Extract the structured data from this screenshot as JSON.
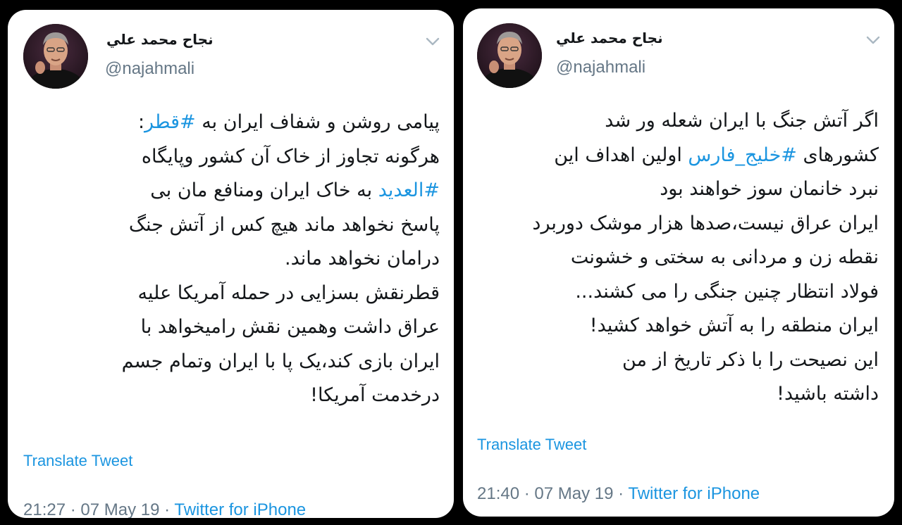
{
  "tweets": [
    {
      "display_name": "نجاح محمد علي",
      "handle": "@najahmali",
      "lines": [
        [
          {
            "t": "پیامی روشن و شفاف ایران به "
          },
          {
            "t": "#قطر",
            "tag": true
          },
          {
            "t": ":"
          }
        ],
        [
          {
            "t": "هرگونه تجاوز از خاک آن کشور وپایگاه"
          }
        ],
        [
          {
            "t": "#العدید",
            "tag": true
          },
          {
            "t": " به خاک ایران ومنافع مان بی"
          }
        ],
        [
          {
            "t": "پاسخ نخواهد ماند هیچ کس از آتش جنگ"
          }
        ],
        [
          {
            "t": "درامان نخواهد ماند."
          }
        ],
        [
          {
            "t": "قطرنقش بسزایی در حمله آمریکا علیه"
          }
        ],
        [
          {
            "t": "عراق داشت وهمین نقش رامیخواهد با"
          }
        ],
        [
          {
            "t": "ایران بازی کند،یک پا با ایران وتمام جسم"
          }
        ],
        [
          {
            "t": "درخدمت آمریکا!"
          }
        ]
      ],
      "translate_label": "Translate Tweet",
      "time": "21:27",
      "date": "07 May 19",
      "source": "Twitter for iPhone"
    },
    {
      "display_name": "نجاح محمد علي",
      "handle": "@najahmali",
      "lines": [
        [
          {
            "t": "اگر آتش جنگ با ایران شعله ور شد"
          }
        ],
        [
          {
            "t": "کشورهای "
          },
          {
            "t": "#خلیج_فارس",
            "tag": true
          },
          {
            "t": " اولین اهداف این"
          }
        ],
        [
          {
            "t": "نبرد خانمان سوز خواهند بود"
          }
        ],
        [
          {
            "t": "ایران عراق نیست،صدها هزار موشک دوربرد"
          }
        ],
        [
          {
            "t": "نقطه زن و مردانی به سختی و خشونت"
          }
        ],
        [
          {
            "t": "فولاد انتظار چنین جنگی را می کشند..."
          }
        ],
        [
          {
            "t": "ایران منطقه را به آتش خواهد کشید!"
          }
        ],
        [
          {
            "t": "این نصیحت را با ذکر تاریخ از من"
          }
        ],
        [
          {
            "t": "داشته باشید!"
          }
        ]
      ],
      "translate_label": "Translate Tweet",
      "time": "21:40",
      "date": "07 May 19",
      "source": "Twitter for iPhone"
    }
  ],
  "colors": {
    "link": "#1b95e0",
    "text": "#14171a",
    "secondary": "#657786",
    "background": "#000000",
    "card": "#ffffff"
  },
  "icons": {
    "caret": "chevron-down-icon",
    "avatar": "profile-photo"
  }
}
